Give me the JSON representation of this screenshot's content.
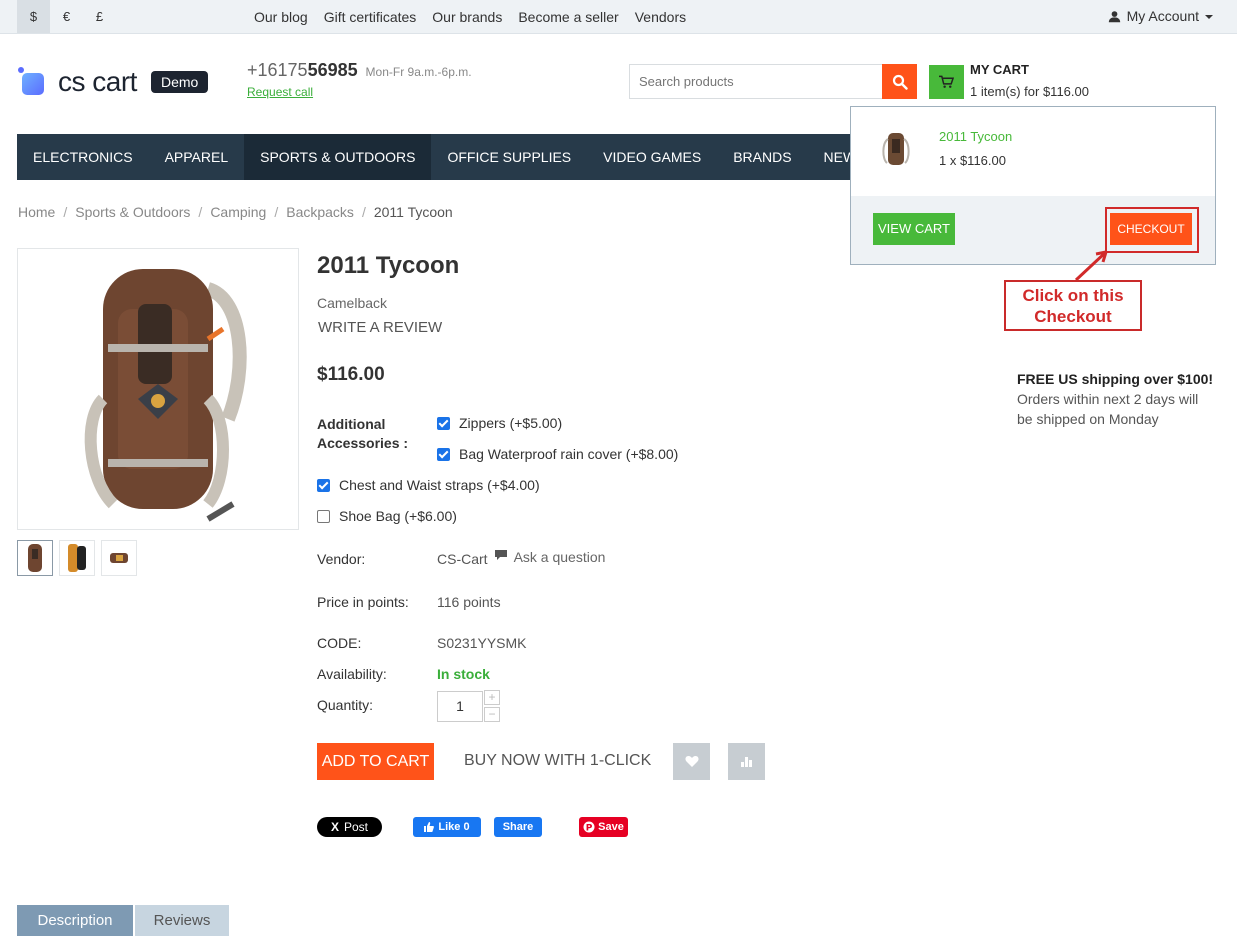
{
  "topbar": {
    "currencies": [
      "$",
      "€",
      "£"
    ],
    "links": [
      "Our blog",
      "Gift certificates",
      "Our brands",
      "Become a seller",
      "Vendors"
    ],
    "account": "My Account"
  },
  "header": {
    "logo_text": "cs cart",
    "demo_badge": "Demo",
    "phone_prefix": "+16175",
    "phone_main": "56985",
    "hours": "Mon-Fr 9a.m.-6p.m.",
    "request_call": "Request call",
    "search_placeholder": "Search products",
    "cart_title": "MY CART",
    "cart_summary": "1 item(s) for $116.00"
  },
  "nav": [
    "ELECTRONICS",
    "APPAREL",
    "SPORTS & OUTDOORS",
    "OFFICE SUPPLIES",
    "VIDEO GAMES",
    "BRANDS",
    "NEWEST"
  ],
  "cart_dropdown": {
    "item_name": "2011 Tycoon",
    "item_qty": "1 x $116.00",
    "view_cart": "VIEW CART",
    "checkout": "CHECKOUT"
  },
  "annotation": {
    "line1": "Click on this",
    "line2": "Checkout"
  },
  "breadcrumbs": [
    "Home",
    "Sports & Outdoors",
    "Camping",
    "Backpacks",
    "2011 Tycoon"
  ],
  "product": {
    "title": "2011 Tycoon",
    "brand": "Camelback",
    "write_review": "WRITE A REVIEW",
    "price": "$116.00",
    "accessories_label_1": "Additional",
    "accessories_label_2": "Accessories :",
    "options": [
      {
        "label": "Zippers (+$5.00)",
        "checked": true
      },
      {
        "label": "Bag Waterproof rain cover (+$8.00)",
        "checked": true
      },
      {
        "label": "Chest and Waist straps (+$4.00)",
        "checked": true
      },
      {
        "label": "Shoe Bag (+$6.00)",
        "checked": false
      }
    ],
    "vendor_label": "Vendor:",
    "vendor_value": "CS-Cart",
    "ask_question": "Ask a question",
    "points_label": "Price in points:",
    "points_value": "116 points",
    "code_label": "CODE:",
    "code_value": "S0231YYSMK",
    "availability_label": "Availability:",
    "availability_value": "In stock",
    "quantity_label": "Quantity:",
    "quantity_value": "1",
    "add_to_cart": "ADD TO CART",
    "buy_now": "BUY NOW WITH 1-CLICK"
  },
  "social": {
    "x_post": "Post",
    "fb_like": "Like 0",
    "fb_share": "Share",
    "pin_save": "Save"
  },
  "shipping": {
    "heading": "FREE US shipping over $100!",
    "line1": "Orders within next 2 days will",
    "line2": "be shipped on Monday"
  },
  "tabs": [
    "Description",
    "Reviews"
  ],
  "colors": {
    "accent_orange": "#ff5319",
    "accent_green": "#48b93a",
    "nav_bg": "#273a4a",
    "annotation_red": "#d12a2a"
  }
}
